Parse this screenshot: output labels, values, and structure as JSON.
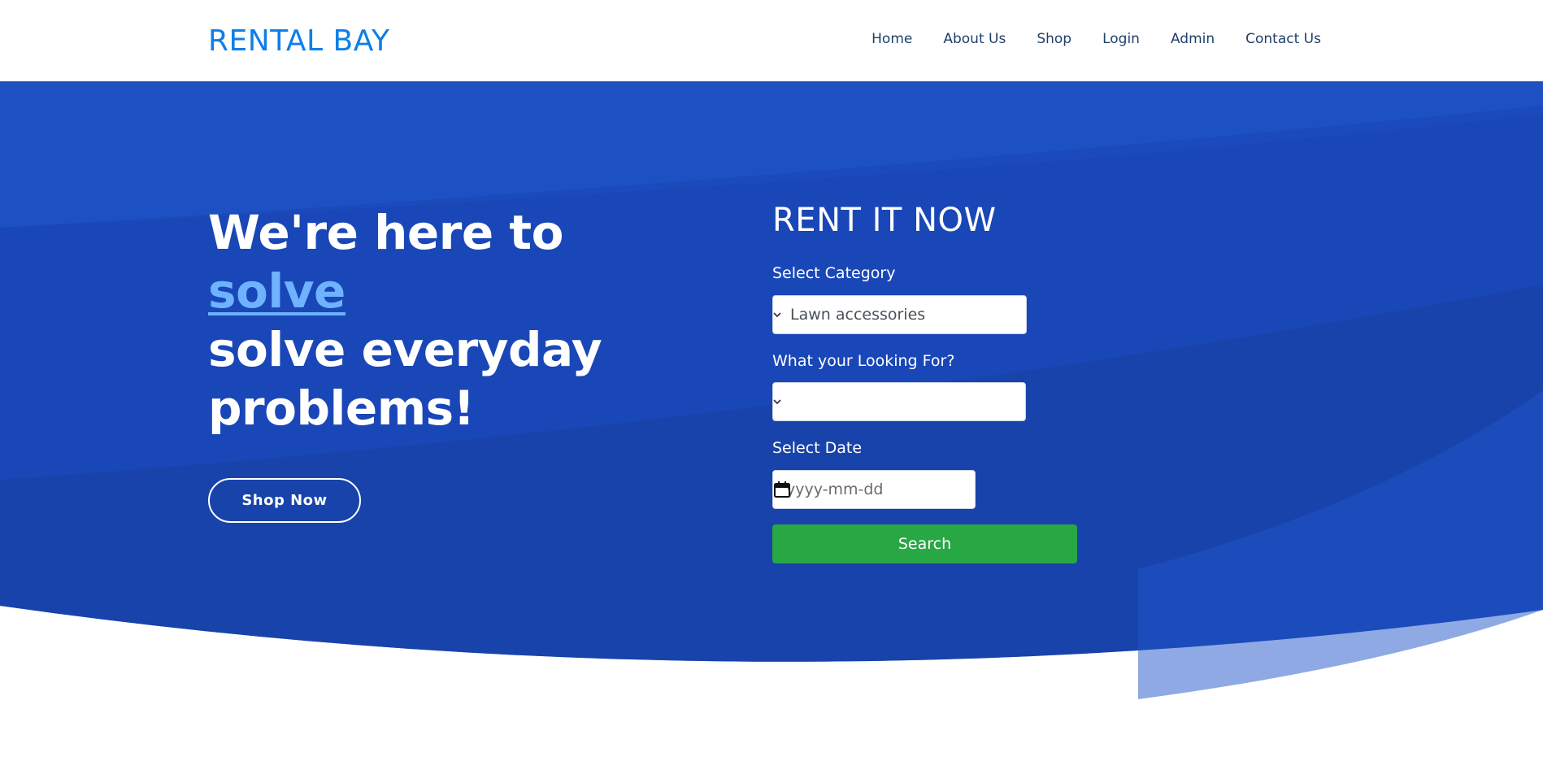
{
  "nav": {
    "brand": "RENTAL BAY",
    "links": [
      "Home",
      "About Us",
      "Shop",
      "Login",
      "Admin",
      "Contact Us"
    ]
  },
  "hero": {
    "headline_line1": "We're here to",
    "headline_highlight": "solve",
    "headline_line3": "solve everyday",
    "headline_line4": "problems!",
    "shop_button": "Shop Now"
  },
  "form": {
    "title": "RENT IT NOW",
    "category_label": "Select Category",
    "category_value": "Lawn accessories",
    "looking_label": "What your Looking For?",
    "looking_value": "",
    "date_label": "Select Date",
    "date_placeholder": "yyyy-mm-dd",
    "search_button": "Search"
  },
  "colors": {
    "brand": "#0d7fe8",
    "hero_bg": "#1a47b8",
    "highlight": "#6fb2ff",
    "search": "#28a745",
    "nav_text": "#1f3f6b"
  },
  "icons": [
    "chevron-down-icon",
    "calendar-icon"
  ]
}
